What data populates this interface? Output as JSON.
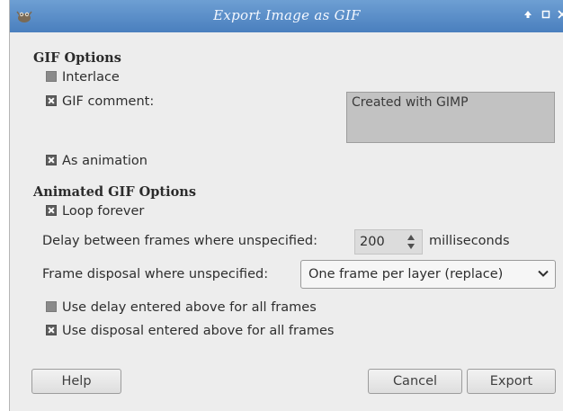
{
  "window": {
    "title": "Export Image as GIF",
    "icons": [
      "gimp-icon",
      "roll-up-icon",
      "maximize-icon",
      "close-icon"
    ]
  },
  "gif_options": {
    "heading": "GIF Options",
    "interlace": {
      "label": "Interlace",
      "checked": false
    },
    "gif_comment": {
      "label": "GIF comment:",
      "checked": true,
      "value": "Created with GIMP"
    },
    "as_animation": {
      "label": "As animation",
      "checked": true
    }
  },
  "animated_options": {
    "heading": "Animated GIF Options",
    "loop_forever": {
      "label": "Loop forever",
      "checked": true
    },
    "delay_label": "Delay between frames where unspecified:",
    "delay_value": "200",
    "delay_unit": "milliseconds",
    "disposal_label": "Frame disposal where unspecified:",
    "disposal_value": "One frame per layer (replace)",
    "use_delay": {
      "label": "Use delay entered above for all frames",
      "checked": false
    },
    "use_disposal": {
      "label": "Use disposal entered above for all frames",
      "checked": true
    }
  },
  "buttons": {
    "help": "Help",
    "cancel": "Cancel",
    "export": "Export"
  },
  "colors": {
    "titlebar": "#4a7fbe",
    "dialog_bg": "#ededed",
    "comment_bg": "#c2c2c2"
  }
}
